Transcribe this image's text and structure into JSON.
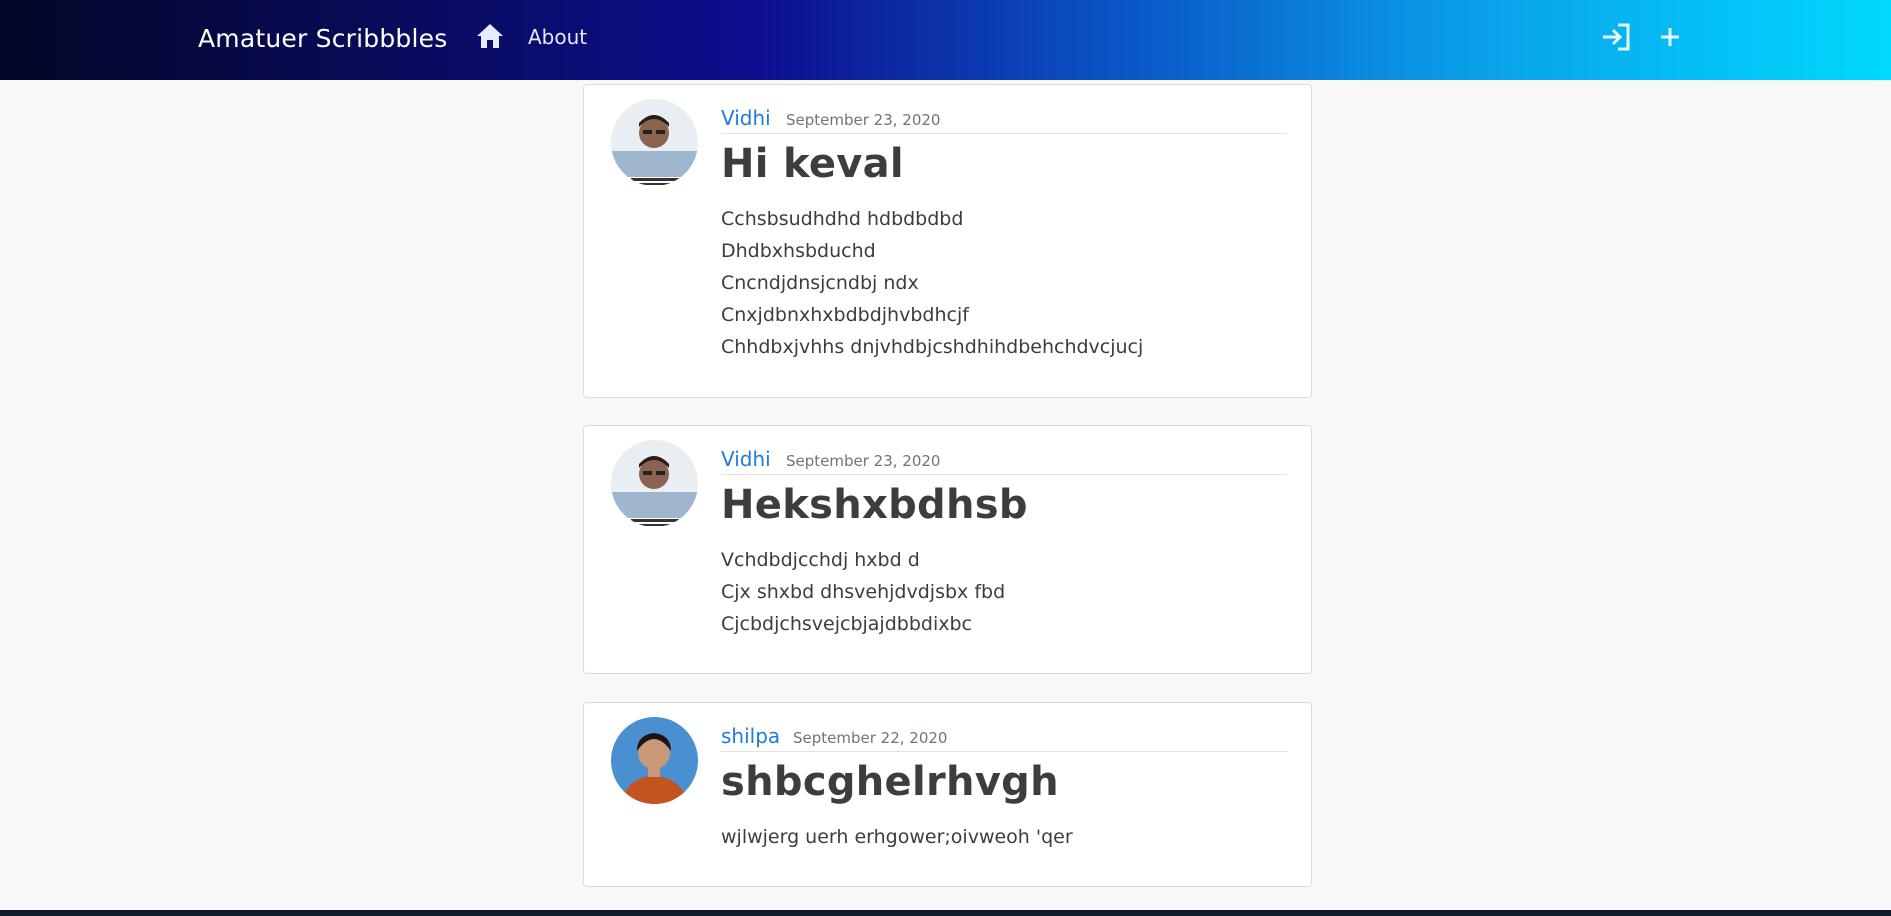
{
  "app": {
    "brand": "Amatuer Scribbbles"
  },
  "nav": {
    "home_icon": "home-icon",
    "about_label": "About",
    "login_icon": "login-icon",
    "add_icon": "plus-icon"
  },
  "colors": {
    "author_link": "#1e7be3",
    "nav_gradient_start": "#030626",
    "nav_gradient_end": "#00d9ff"
  },
  "posts": [
    {
      "author": "Vidhi",
      "date": "September 23, 2020",
      "title": "Hi keval",
      "lines": [
        "Cchsbsudhdhd hdbdbdbd",
        "Dhdbxhsbduchd",
        "Cncndjdnsjcndbj ndx",
        "Cnxjdbnxhxbdbdjhvbdhcjf",
        "Chhdbxjvhhs dnjvhdbjcshdhihdbehchdvcjucj"
      ]
    },
    {
      "author": "Vidhi",
      "date": "September 23, 2020",
      "title": "Hekshxbdhsb",
      "lines": [
        "Vchdbdjcchdj hxbd d",
        "Cjx shxbd dhsvehjdvdjsbx fbd",
        "Cjcbdjchsvejcbjajdbbdixbc"
      ]
    },
    {
      "author": "shilpa",
      "date": "September 22, 2020",
      "title": "shbcghelrhvgh",
      "lines": [
        "wjlwjerg uerh erhgower;oivweoh 'qer"
      ]
    }
  ]
}
